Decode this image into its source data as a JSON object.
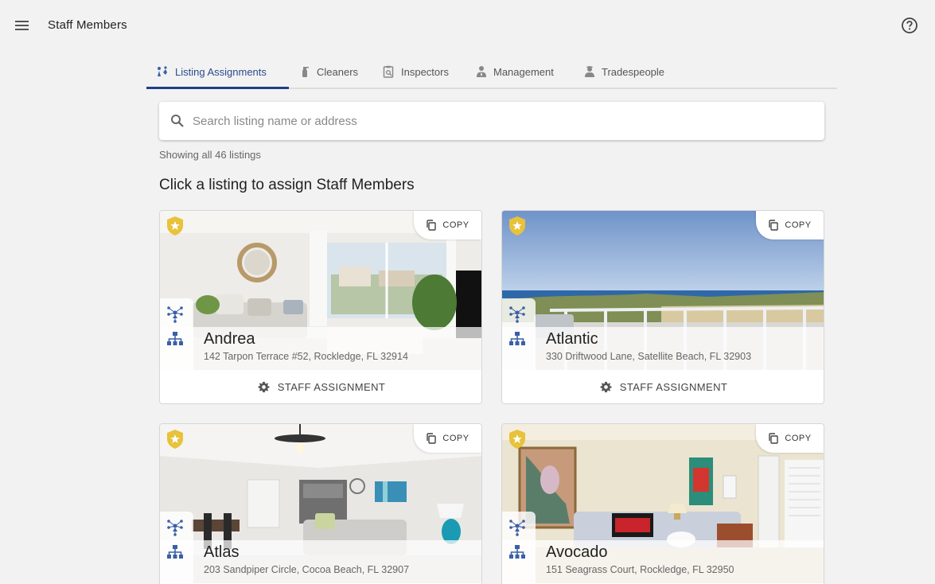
{
  "app": {
    "title": "Staff Members"
  },
  "icons": {
    "menu": "menu-icon",
    "help": "help-circle-icon",
    "search": "search-icon",
    "copy": "copy-icon",
    "settings": "gear-icon",
    "star_badge": "star-badge-icon",
    "staff": "staff-network-icon",
    "hierarchy": "hierarchy-icon"
  },
  "colors": {
    "accent": "#1f3f86",
    "icon_blue": "#3a5fa8",
    "badge_gold": "#e8c23a",
    "background": "#f2f2f2"
  },
  "tabs": [
    {
      "label": "Listing Assignments",
      "active": true
    },
    {
      "label": "Cleaners",
      "active": false
    },
    {
      "label": "Inspectors",
      "active": false
    },
    {
      "label": "Management",
      "active": false
    },
    {
      "label": "Tradespeople",
      "active": false
    }
  ],
  "search": {
    "placeholder": "Search listing name or address",
    "value": ""
  },
  "listing_count_text": "Showing all 46 listings",
  "instruction": "Click a listing to assign Staff Members",
  "listings": [
    {
      "name": "Andrea",
      "address": "142 Tarpon Terrace #52, Rockledge, FL 32914",
      "copy_label": "COPY",
      "action_label": "STAFF ASSIGNMENT"
    },
    {
      "name": "Atlantic",
      "address": "330 Driftwood Lane, Satellite Beach, FL 32903",
      "copy_label": "COPY",
      "action_label": "STAFF ASSIGNMENT"
    },
    {
      "name": "Atlas",
      "address": "203 Sandpiper Circle, Cocoa Beach, FL 32907",
      "copy_label": "COPY"
    },
    {
      "name": "Avocado",
      "address": "151 Seagrass Court, Rockledge, FL 32950",
      "copy_label": "COPY"
    }
  ]
}
